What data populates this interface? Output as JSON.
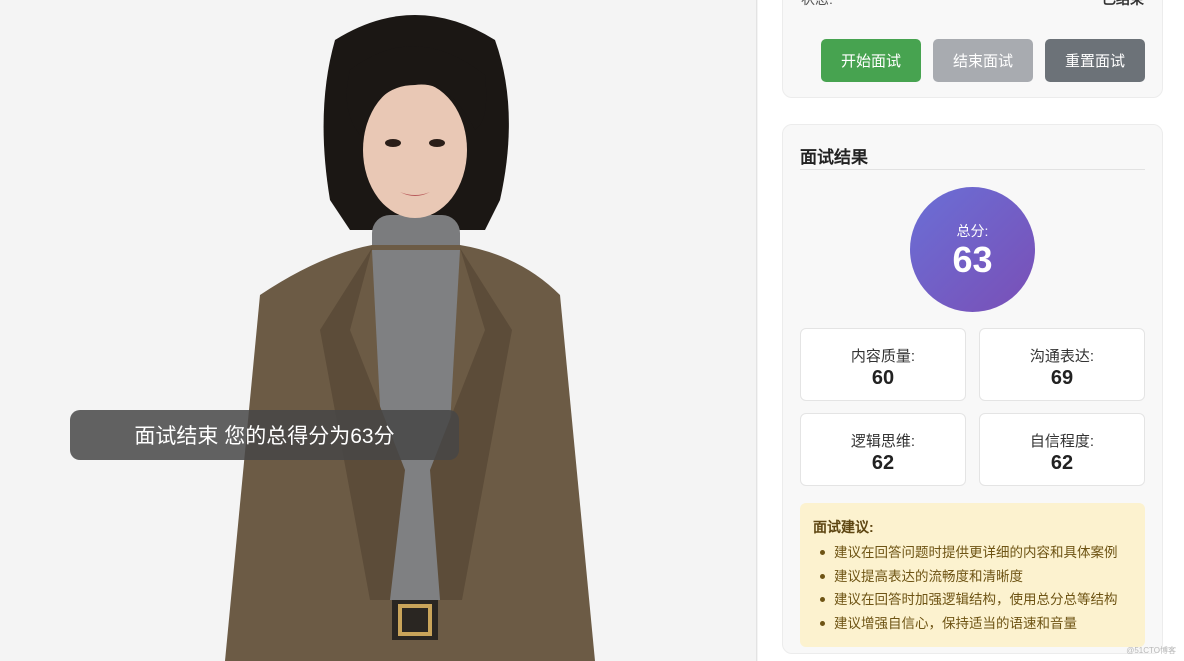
{
  "subtitle": "面试结束 您的总得分为63分",
  "controls": {
    "status_label": "状态:",
    "status_value": "已结束",
    "start_label": "开始面试",
    "end_label": "结束面试",
    "reset_label": "重置面试"
  },
  "result": {
    "title": "面试结果",
    "total_label": "总分:",
    "total_value": "63",
    "metrics": [
      {
        "label": "内容质量:",
        "value": "60"
      },
      {
        "label": "沟通表达:",
        "value": "69"
      },
      {
        "label": "逻辑思维:",
        "value": "62"
      },
      {
        "label": "自信程度:",
        "value": "62"
      }
    ],
    "advice_title": "面试建议:",
    "advice_items": [
      "建议在回答问题时提供更详细的内容和具体案例",
      "建议提高表达的流畅度和清晰度",
      "建议在回答时加强逻辑结构，使用总分总等结构",
      "建议增强自信心，保持适当的语速和音量"
    ]
  },
  "watermark": "@51CTO博客",
  "colors": {
    "start_button": "#47a350",
    "end_button": "#a8abb0",
    "reset_button": "#6c7278",
    "score_gradient_start": "#6a6fd6",
    "score_gradient_end": "#7a4fb6",
    "advice_background": "#fcf2cf"
  }
}
